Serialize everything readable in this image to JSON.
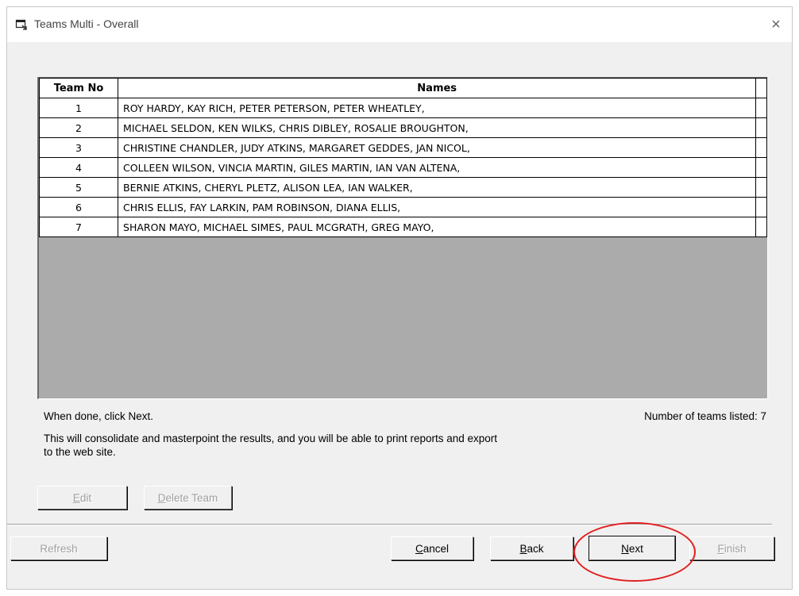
{
  "window": {
    "title": "Teams Multi - Overall",
    "icon": "window-app-icon",
    "close_glyph": "×"
  },
  "grid": {
    "headers": {
      "team_no": "Team No",
      "names": "Names"
    },
    "rows": [
      {
        "team_no": "1",
        "names": "ROY HARDY, KAY RICH, PETER PETERSON, PETER WHEATLEY,"
      },
      {
        "team_no": "2",
        "names": "MICHAEL SELDON, KEN WILKS, CHRIS DIBLEY, ROSALIE BROUGHTON,"
      },
      {
        "team_no": "3",
        "names": "CHRISTINE CHANDLER, JUDY ATKINS, MARGARET GEDDES, JAN NICOL,"
      },
      {
        "team_no": "4",
        "names": "COLLEEN WILSON, VINCIA MARTIN, GILES MARTIN, IAN VAN ALTENA,"
      },
      {
        "team_no": "5",
        "names": "BERNIE ATKINS, CHERYL PLETZ, ALISON LEA, IAN WALKER,"
      },
      {
        "team_no": "6",
        "names": "CHRIS ELLIS, FAY LARKIN, PAM ROBINSON, DIANA ELLIS,"
      },
      {
        "team_no": "7",
        "names": "SHARON MAYO, MICHAEL SIMES, PAUL MCGRATH, GREG MAYO,"
      }
    ]
  },
  "messages": {
    "done": "When done, click Next.",
    "count": "Number of teams listed: 7",
    "info": "This will consolidate and  masterpoint the results, and you will be able to print reports and export to the web site."
  },
  "buttons": {
    "edit": {
      "mnemonic": "E",
      "rest": "dit",
      "enabled": false
    },
    "delete_team": {
      "mnemonic": "D",
      "rest": "elete Team",
      "enabled": false
    },
    "refresh": {
      "label": "Refresh",
      "enabled": false
    },
    "cancel": {
      "mnemonic": "C",
      "rest": "ancel",
      "enabled": true
    },
    "back": {
      "mnemonic": "B",
      "rest": "ack",
      "enabled": true
    },
    "next": {
      "mnemonic": "N",
      "rest": "ext",
      "enabled": true
    },
    "finish": {
      "mnemonic": "F",
      "rest": "inish",
      "enabled": false
    }
  },
  "colors": {
    "dialog_bg": "#f0f0f0",
    "grid_empty_bg": "#ababab",
    "annotation": "#e02020",
    "disabled_text": "#a0a0a0"
  }
}
